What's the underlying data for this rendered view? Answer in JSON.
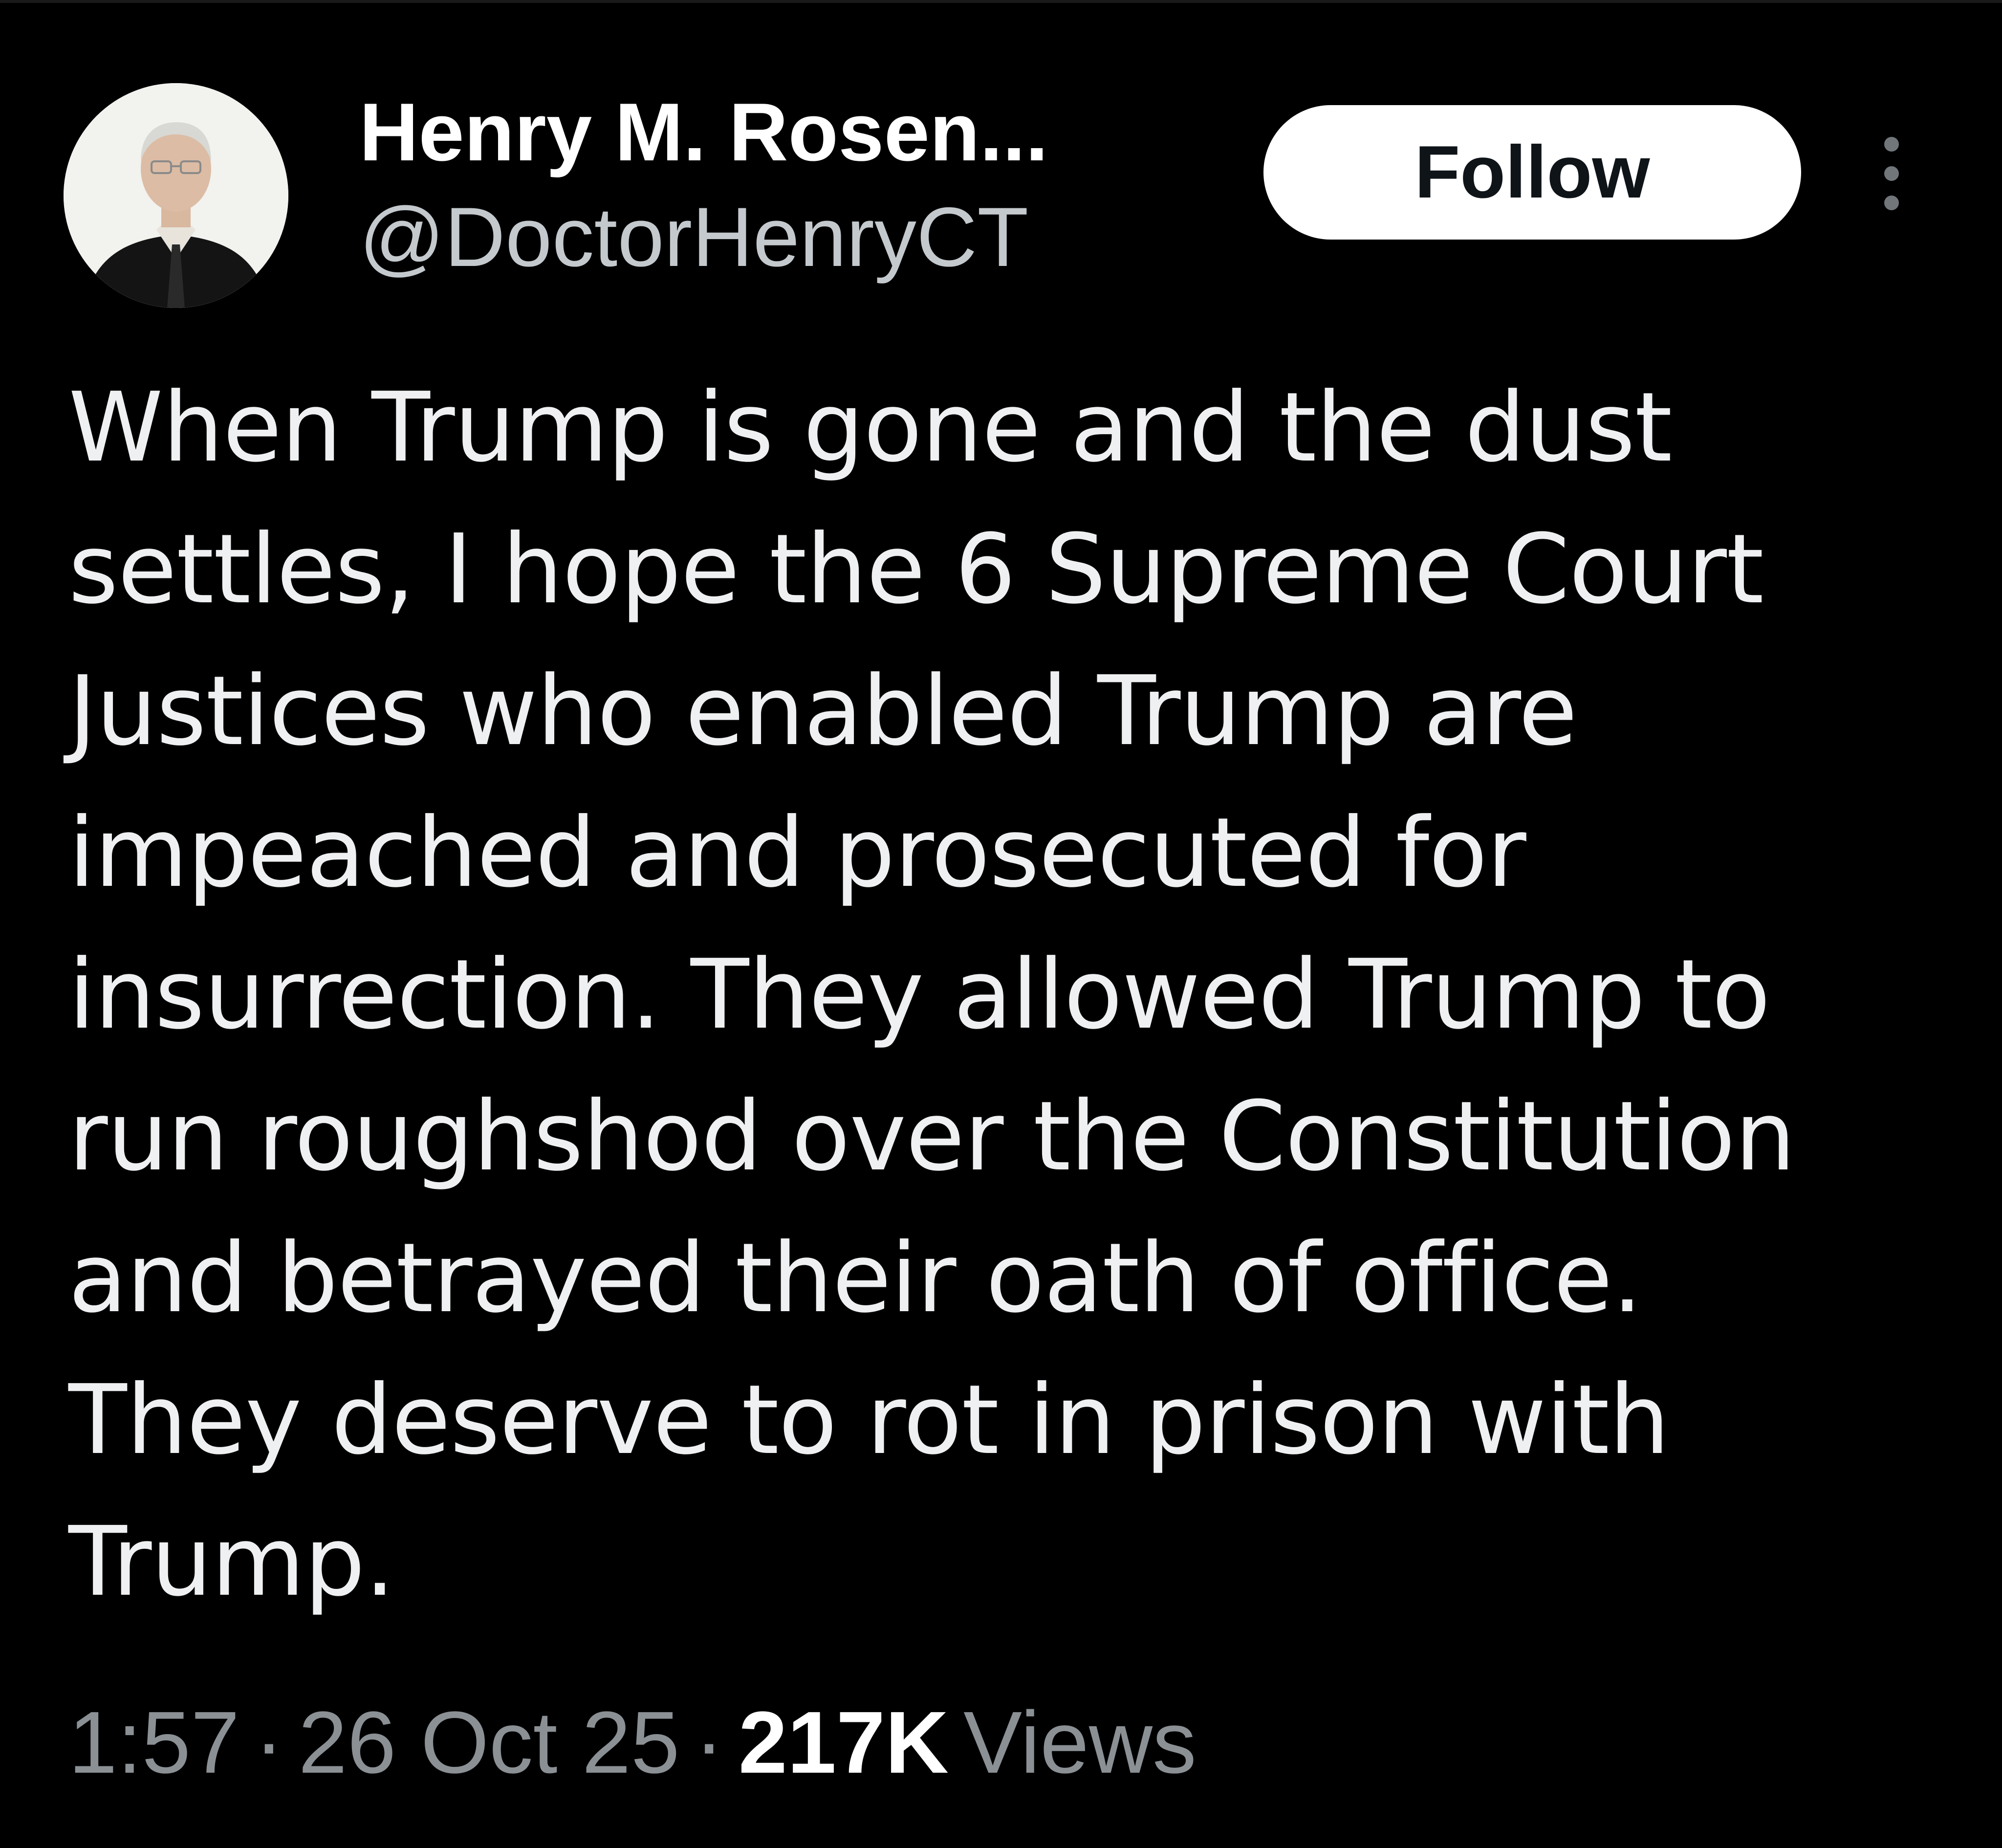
{
  "tweet": {
    "author": {
      "display_name": "Henry M. Rosen...",
      "handle": "@DoctorHenryCT"
    },
    "follow_label": "Follow",
    "more_icon": "more-vertical-icon",
    "text": "When Trump is gone and the dust\nsettles, I hope the 6 Supreme Court\nJustices who enabled Trump are\nimpeached and prosecuted for\ninsurrection. They allowed Trump to\nrun roughshod over the Constitution\nand betrayed their oath of office.\nThey deserve to rot in prison with\nTrump.",
    "time": "1:57",
    "separator": "·",
    "date": "26 Oct 25",
    "views_count": "217K",
    "views_label": "Views"
  },
  "colors": {
    "background": "#000000",
    "text": "#e7e9ea",
    "secondary_text": "#8b9095",
    "follow_bg": "#ffffff",
    "follow_text": "#0f1419"
  }
}
